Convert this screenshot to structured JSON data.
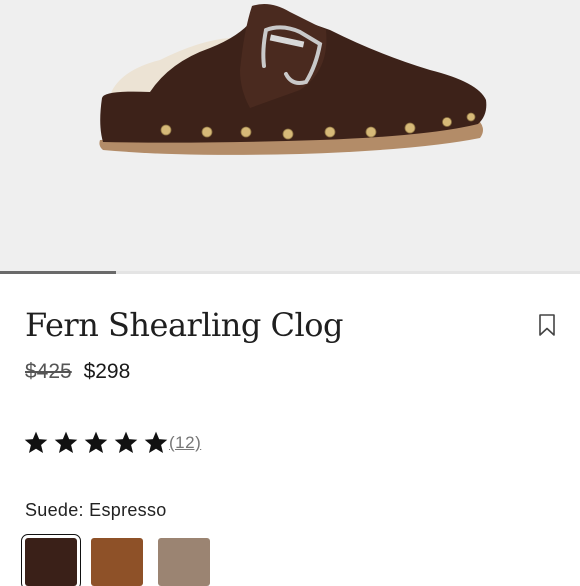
{
  "product": {
    "title": "Fern Shearling Clog",
    "price_original": "$425",
    "price_sale": "$298",
    "rating": {
      "stars": 5,
      "count_label": "(12)"
    },
    "variant": {
      "label": "Suede: Espresso"
    },
    "swatches": [
      {
        "name": "Espresso",
        "color": "#3a2018",
        "selected": true
      },
      {
        "name": "Cognac",
        "color": "#8e5128",
        "selected": false
      },
      {
        "name": "Taupe",
        "color": "#9b8472",
        "selected": false
      }
    ]
  },
  "gallery": {
    "progress": 0.2
  },
  "icons": {
    "bookmark": "bookmark-icon",
    "star": "star-icon"
  },
  "colors": {
    "hero_bg": "#efefef",
    "shoe": "#3d2219",
    "sole": "#b38c68",
    "stud": "#d6b978"
  }
}
